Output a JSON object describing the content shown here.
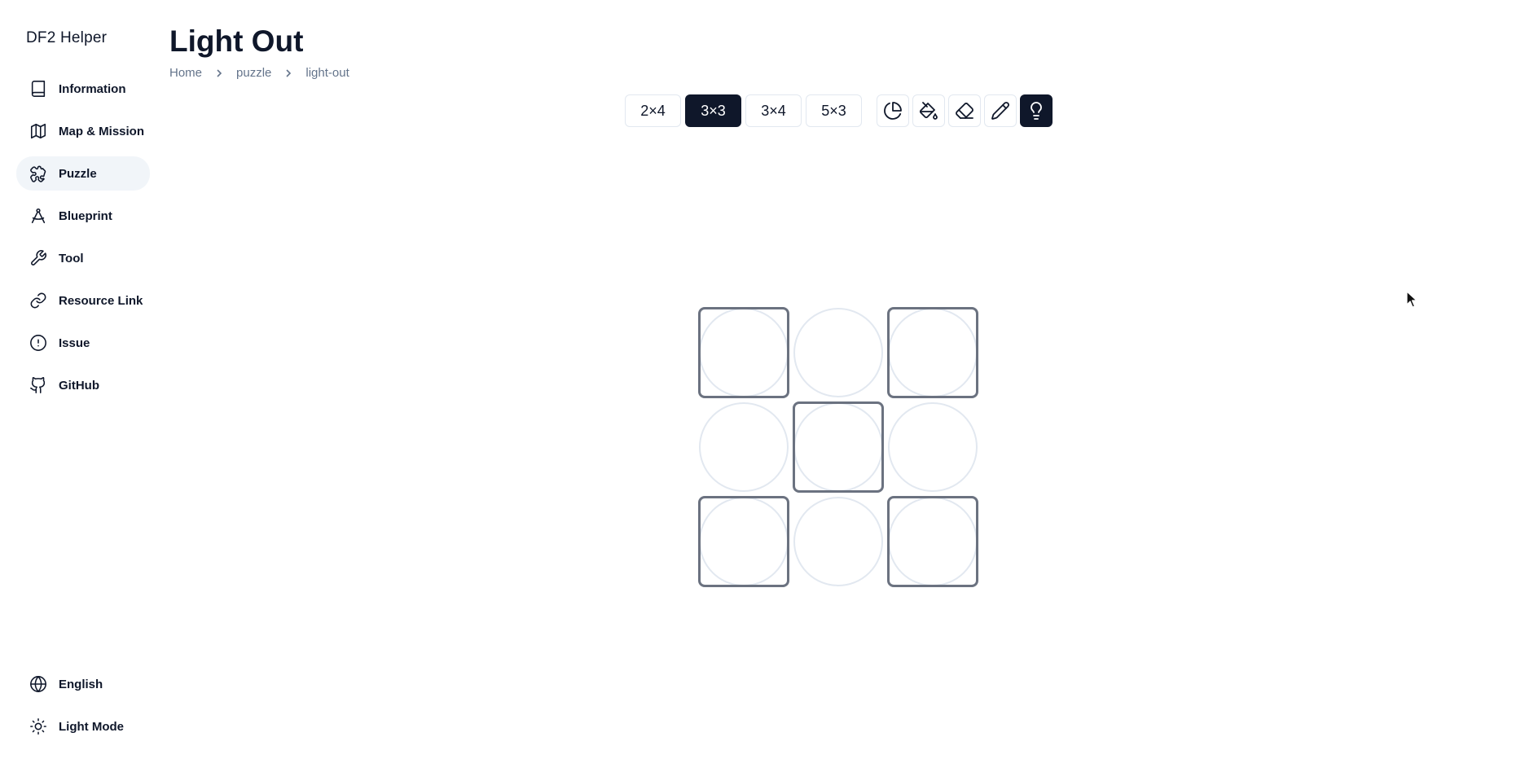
{
  "app": {
    "brand": "DF2 Helper"
  },
  "sidebar": {
    "items": [
      {
        "label": "Information",
        "icon": "book-icon"
      },
      {
        "label": "Map & Mission",
        "icon": "map-icon"
      },
      {
        "label": "Puzzle",
        "icon": "puzzle-icon",
        "active": true
      },
      {
        "label": "Blueprint",
        "icon": "compass-icon"
      },
      {
        "label": "Tool",
        "icon": "wrench-icon"
      },
      {
        "label": "Resource Link",
        "icon": "link-icon"
      },
      {
        "label": "Issue",
        "icon": "alert-circle-icon"
      },
      {
        "label": "GitHub",
        "icon": "github-icon"
      }
    ],
    "bottom": [
      {
        "label": "English",
        "icon": "globe-icon"
      },
      {
        "label": "Light Mode",
        "icon": "sun-icon"
      }
    ]
  },
  "page": {
    "title": "Light Out",
    "breadcrumb": [
      "Home",
      "puzzle",
      "light-out"
    ]
  },
  "toolbar": {
    "sizes": [
      "2×4",
      "3×3",
      "3×4",
      "5×3"
    ],
    "selected_size": "3×3",
    "tools": [
      {
        "name": "pie-chart-icon",
        "active": false
      },
      {
        "name": "paint-bucket-icon",
        "active": false
      },
      {
        "name": "eraser-icon",
        "active": false
      },
      {
        "name": "pencil-icon",
        "active": false
      },
      {
        "name": "lightbulb-icon",
        "active": true
      }
    ]
  },
  "board": {
    "rows": 3,
    "cols": 3,
    "cells": [
      [
        true,
        false,
        true
      ],
      [
        false,
        true,
        false
      ],
      [
        true,
        false,
        true
      ]
    ]
  },
  "colors": {
    "primary": "#0f172a",
    "muted": "#64748b",
    "border": "#e2e8f0",
    "active_bg": "#f1f5f9",
    "cell_frame": "#6b7280"
  }
}
